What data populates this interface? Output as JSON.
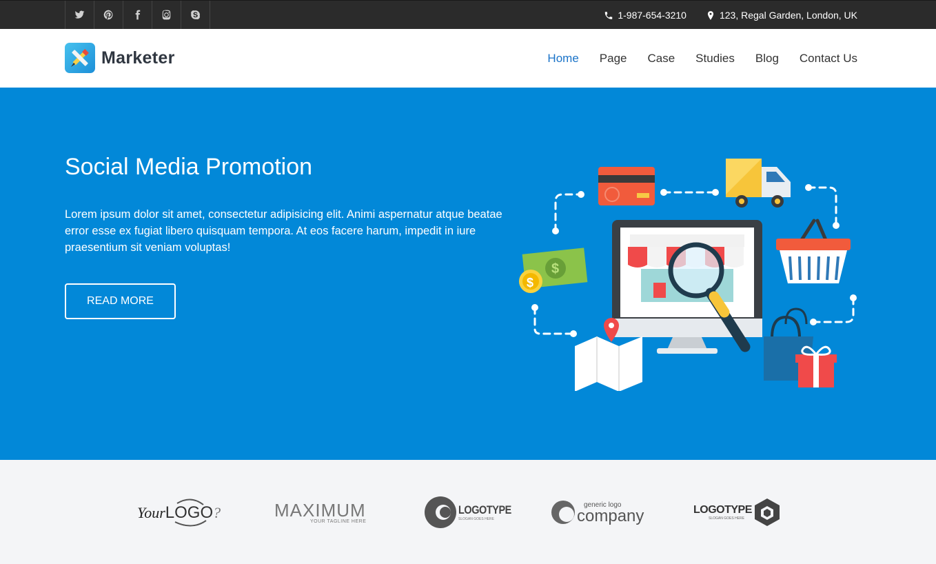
{
  "topbar": {
    "social": [
      {
        "name": "twitter-icon"
      },
      {
        "name": "pinterest-icon"
      },
      {
        "name": "facebook-icon"
      },
      {
        "name": "instagram-icon"
      },
      {
        "name": "skype-icon"
      }
    ],
    "phone": "1-987-654-3210",
    "address": "123, Regal Garden, London, UK"
  },
  "header": {
    "brand": "Marketer",
    "nav": [
      "Home",
      "Page",
      "Case",
      "Studies",
      "Blog",
      "Contact Us"
    ],
    "active": "Home"
  },
  "hero": {
    "title": "Social Media Promotion",
    "text": "Lorem ipsum dolor sit amet, consectetur adipisicing elit. Animi aspernatur atque beatae error esse ex fugiat libero quisquam tempora. At eos facere harum, impedit in iure praesentium sit veniam voluptas!",
    "button": "READ MORE"
  },
  "brands": {
    "logo1": {
      "a": "Your",
      "b": "LOGO",
      "c": "?"
    },
    "logo2": {
      "main": "MAXIMUM",
      "tag": "YOUR TAGLINE HERE"
    },
    "logo3": {
      "main": "LOGOTYPE",
      "tag": "SLOGAN GOES HERE"
    },
    "logo4": {
      "small": "generic logo",
      "main": "company"
    },
    "logo5": {
      "main": "LOGOTYPE",
      "tag": "SLOGAN GOES HERE"
    }
  },
  "colors": {
    "hero_bg": "#0288d8",
    "topbar_bg": "#2b2b2b",
    "nav_active": "#1a73c8"
  }
}
